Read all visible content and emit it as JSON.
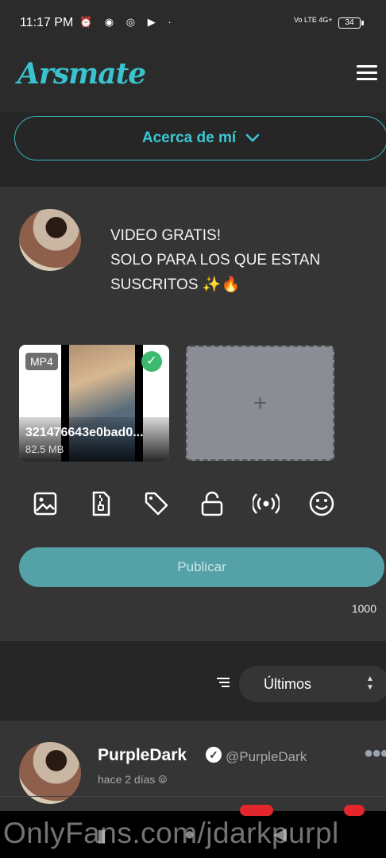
{
  "status_bar": {
    "time": "11:17 PM",
    "icons": [
      "alarm-icon",
      "whatsapp-icon",
      "instagram-icon",
      "play-icon",
      "dot"
    ],
    "network": "Vo LTE 4G+",
    "battery": "34"
  },
  "header": {
    "logo": "Arsmate"
  },
  "about": {
    "label": "Acerca de mí"
  },
  "composer": {
    "post_text": "VIDEO GRATIS!\n SOLO PARA LOS QUE ESTAN\nSUSCRITOS ✨🔥",
    "media": {
      "badge": "MP4",
      "filename": "321476643e0bad0...",
      "size": "82.5 MB"
    },
    "add_label": "+",
    "tools": [
      "image-icon",
      "zip-file-icon",
      "tag-icon",
      "unlock-icon",
      "broadcast-icon",
      "emoji-icon"
    ],
    "publish_label": "Publicar",
    "char_count": "1000"
  },
  "sort": {
    "selected": "Últimos"
  },
  "post": {
    "name": "PurpleDark",
    "handle": "@PurpleDark",
    "time": "hace 2 días"
  },
  "watermark": "OnlyFans.com/jdarkpurpl",
  "colors": {
    "accent": "#38c3cf",
    "publish_bg": "#54a2a8",
    "card_bg": "#353535",
    "page_bg": "#2b2b2b"
  }
}
